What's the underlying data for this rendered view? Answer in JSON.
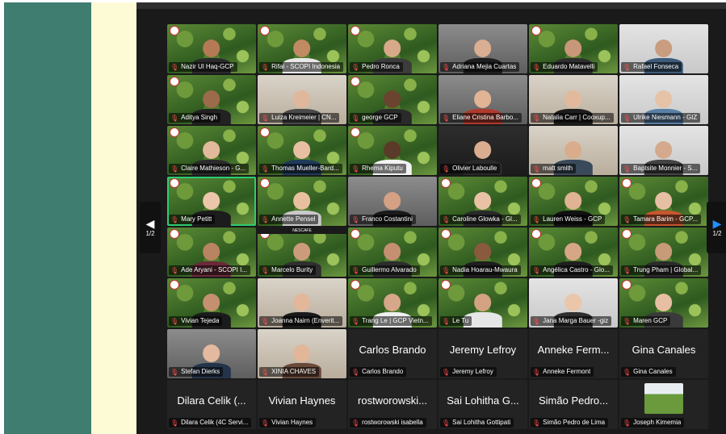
{
  "pagination": {
    "left_label": "1/2",
    "right_label": "1/2"
  },
  "participants": [
    {
      "name": "Nazir Ul Haq-GCP",
      "bg": "green",
      "skin": "#b47a55",
      "shirt": "#2a2a2a"
    },
    {
      "name": "Rifai - SCOPI Indonesia",
      "bg": "green",
      "skin": "#c08a62",
      "shirt": "#e8e8e8"
    },
    {
      "name": "Pedro Ronca",
      "bg": "green",
      "skin": "#d7a98a",
      "shirt": "#3c3c3c"
    },
    {
      "name": "Adriana Mejia Cuartas",
      "bg": "office",
      "skin": "#d9ae92",
      "shirt": "#1e1e1e"
    },
    {
      "name": "Eduardo Matavelli",
      "bg": "green",
      "skin": "#c8977a",
      "shirt": "#2f2f2f"
    },
    {
      "name": "Rafael Fonseca",
      "bg": "wall",
      "skin": "#c99d7f",
      "shirt": "#3d5b7a"
    },
    {
      "name": "Aditya Singh",
      "bg": "green",
      "skin": "#9b6b4c",
      "shirt": "#222222"
    },
    {
      "name": "Luiza Kreimeier | CN...",
      "bg": "room",
      "skin": "#e0b79a",
      "shirt": "#4a4a4a"
    },
    {
      "name": "george GCP",
      "bg": "green",
      "skin": "#6b4430",
      "shirt": "#2a2a2a"
    },
    {
      "name": "Eliane Cristina Barbo...",
      "bg": "office",
      "skin": "#e1b496",
      "shirt": "#b03a2e"
    },
    {
      "name": "Natalia Carr | Cooxup...",
      "bg": "room",
      "skin": "#e3b99e",
      "shirt": "#1d1d1d"
    },
    {
      "name": "Ulrike Niesmann - GIZ",
      "bg": "wall",
      "skin": "#e6c2a6",
      "shirt": "#5a7fa6"
    },
    {
      "name": "Claire Mathieson - G...",
      "bg": "green",
      "skin": "#e3b99c",
      "shirt": "#2b2b2b"
    },
    {
      "name": "Thomas Mueller-Bard...",
      "bg": "green",
      "skin": "#e8bfa2",
      "shirt": "#1f3b5a"
    },
    {
      "name": "Rhema Kiputu",
      "bg": "green",
      "skin": "#5a3a28",
      "shirt": "#f2f2f2"
    },
    {
      "name": "Olivier Laboulle",
      "bg": "dark",
      "skin": "#d8ad90",
      "shirt": "#2a2a2a"
    },
    {
      "name": "matt smith",
      "bg": "room",
      "skin": "#d9ac8c",
      "shirt": "#3a4a5a"
    },
    {
      "name": "Baptsite Monnier - S...",
      "bg": "wall",
      "skin": "#d5a98d",
      "shirt": "#444444"
    },
    {
      "name": "Mary Petitt",
      "bg": "green",
      "skin": "#ecc6aa",
      "shirt": "#1c1c1c",
      "active": true
    },
    {
      "name": "Annette Pensel",
      "bg": "green",
      "skin": "#e8c09f",
      "shirt": "#c9c9c9"
    },
    {
      "name": "Franco Costantini",
      "bg": "office",
      "skin": "#d4a184",
      "shirt": "#1a1a1a"
    },
    {
      "name": "Caroline Glowka - Gl...",
      "bg": "green",
      "skin": "#e9c2a6",
      "shirt": "#2a2a2a"
    },
    {
      "name": "Lauren Weiss - GCP",
      "bg": "green",
      "skin": "#e0b394",
      "shirt": "#111111"
    },
    {
      "name": "Tamara Barim - GCP...",
      "bg": "green",
      "skin": "#e7c0a3",
      "shirt": "#c5572f"
    },
    {
      "name": "Ade Aryani - SCOPI I...",
      "bg": "green",
      "skin": "#b98461",
      "shirt": "#6a2a3a"
    },
    {
      "name": "Marcelo Burity",
      "bg": "green",
      "skin": "#cc9b7c",
      "shirt": "#2f2f2f",
      "brand": "NESCAFE"
    },
    {
      "name": "Guillermo Alvarado",
      "bg": "green",
      "skin": "#c59072",
      "shirt": "#2d2d2d"
    },
    {
      "name": "Nadia Hoarau-Mwaura",
      "bg": "green",
      "skin": "#8a5a3e",
      "shirt": "#1e1e1e"
    },
    {
      "name": "Angélica Castro - Glo...",
      "bg": "green",
      "skin": "#d7a687",
      "shirt": "#1f1f1f"
    },
    {
      "name": "Trung Pham | Global...",
      "bg": "green",
      "skin": "#c79a78",
      "shirt": "#2b2b2b"
    },
    {
      "name": "Vivian Tejeda",
      "bg": "green",
      "skin": "#c49070",
      "shirt": "#1b1b1b"
    },
    {
      "name": "Joanna Nairn (Enverit...",
      "bg": "room",
      "skin": "#e2b79a",
      "shirt": "#1a1a1a"
    },
    {
      "name": "Trang Le | GCP Vietn...",
      "bg": "green",
      "skin": "#d6a788",
      "shirt": "#f0f0f0"
    },
    {
      "name": "Le Tu",
      "bg": "green",
      "skin": "#d3a283",
      "shirt": "#e6e6e6"
    },
    {
      "name": "Jana Marga Bauer -giz",
      "bg": "wall",
      "skin": "#ebc6ab",
      "shirt": "#2f2f2f"
    },
    {
      "name": "Maren GCP",
      "bg": "green",
      "skin": "#e6bea1",
      "shirt": "#3a3a3a"
    },
    {
      "name": "Stefan Dierks",
      "bg": "office",
      "skin": "#e3ba9d",
      "shirt": "#24344a"
    },
    {
      "name": "XINIA CHAVES",
      "bg": "room",
      "skin": "#e2b699",
      "shirt": "#6a4a3a"
    },
    {
      "name": "Carlos Brando",
      "bg": "plain",
      "display": "Carlos Brando"
    },
    {
      "name": "Jeremy Lefroy",
      "bg": "plain",
      "display": "Jeremy Lefroy"
    },
    {
      "name": "Anneke Fermont",
      "bg": "plain",
      "display": "Anneke Ferm..."
    },
    {
      "name": "Gina Canales",
      "bg": "plain",
      "display": "Gina Canales"
    },
    {
      "name": "Dilara Celik (4C Servi...",
      "bg": "plain",
      "display": "Dilara Celik (..."
    },
    {
      "name": "Vivian Haynes",
      "bg": "plain",
      "display": "Vivian Haynes"
    },
    {
      "name": "rostworowski isabella",
      "bg": "plain",
      "display": "rostworowski..."
    },
    {
      "name": "Sai Lohitha Gottipati",
      "bg": "plain",
      "display": "Sai Lohitha G..."
    },
    {
      "name": "Simão Pedro de Lima",
      "bg": "plain",
      "display": "Simão Pedro..."
    },
    {
      "name": "Joseph Kimemia",
      "bg": "plain",
      "avatar": true
    }
  ]
}
